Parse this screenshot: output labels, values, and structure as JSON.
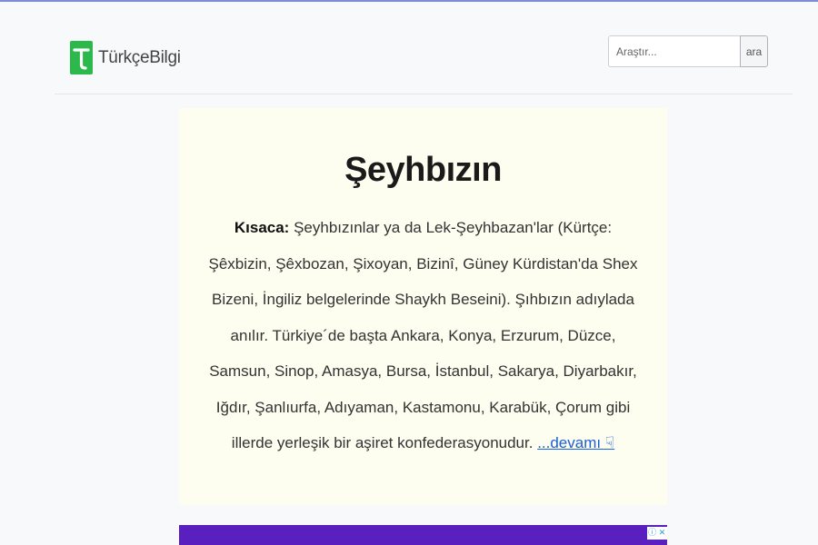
{
  "site": {
    "name": "TürkçeBilgi",
    "logo_icon": "t-letter-logo",
    "brand_color": "#2db84b"
  },
  "search": {
    "placeholder": "Araştır...",
    "button_label": "ara"
  },
  "article": {
    "title": "Şeyhbızın",
    "summary_label": "Kısaca:",
    "summary_text": " Şeyhbızınlar ya da Lek-Şeyhbazan'lar (Kürtçe: Şêxbizin, Şêxbozan, Şixoyan, Bizinî, Güney Kürdistan'da Shex Bizeni, İngiliz belgelerinde Shaykh Beseini). Şıhbızın adıylada anılır. Türkiye´de başta Ankara, Konya, Erzurum, Düzce, Samsun, Sinop, Amasya, Bursa, İstanbul, Sakarya, Diyarbakır, Iğdır, Şanlıurfa, Adıyaman, Kastamonu, Karabük, Çorum gibi illerde yerleşik bir aşiret konfederasyonudur. ",
    "more_link": "...devamı ☟"
  },
  "ad": {
    "background": "#5a1fbf",
    "info_icon": "info-icon",
    "close_icon": "close-icon"
  }
}
